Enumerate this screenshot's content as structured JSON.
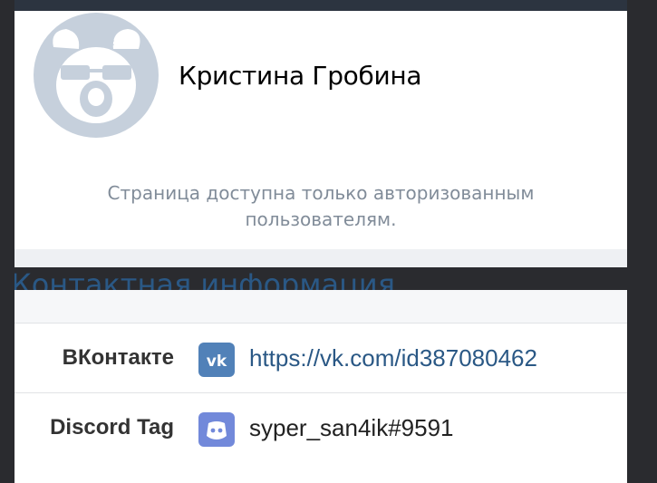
{
  "profile": {
    "name": "Кристина Гробина",
    "private_note": "Страница доступна только авторизованным пользователям."
  },
  "contacts": {
    "heading": "Контактная информация",
    "rows": [
      {
        "label": "ВКонтакте",
        "value": "https://vk.com/id387080462",
        "icon": "vk-icon"
      },
      {
        "label": "Discord Tag",
        "value": "syper_san4ik#9591",
        "icon": "discord-icon"
      }
    ]
  },
  "colors": {
    "link": "#2a5885",
    "vk": "#5181b8",
    "discord": "#7289da",
    "avatar_bg": "#c6d0dc"
  }
}
